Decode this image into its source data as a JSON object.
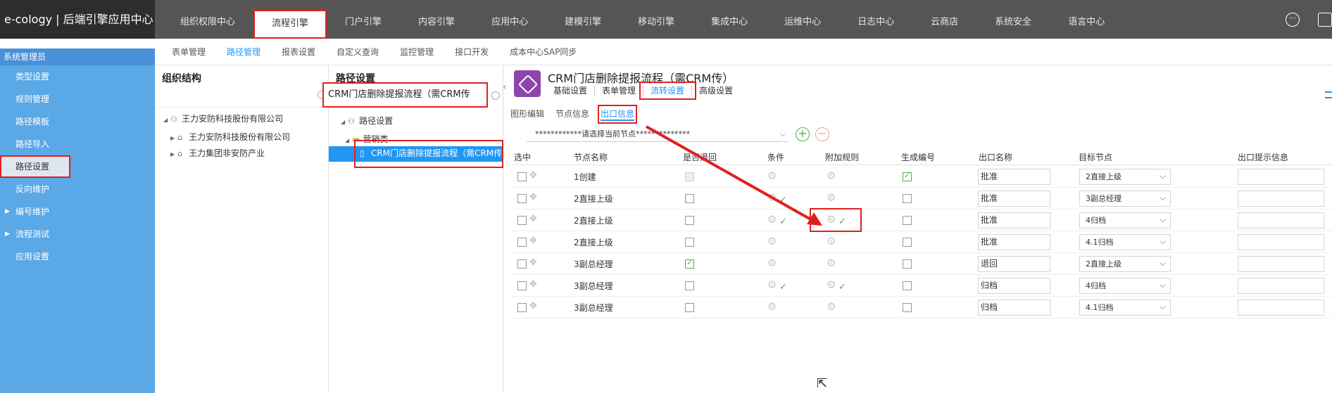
{
  "app": {
    "title": "e-cology | 后端引擎应用中心"
  },
  "topnav": {
    "tabs": [
      "组织权限中心",
      "流程引擎",
      "门户引擎",
      "内容引擎",
      "应用中心",
      "建模引擎",
      "移动引擎",
      "集成中心",
      "运维中心",
      "日志中心",
      "云商店",
      "系统安全",
      "语言中心"
    ],
    "active": "流程引擎",
    "more_icon": "ellipsis-circle-icon"
  },
  "role": "系统管理员",
  "subnav": {
    "items": [
      "表单管理",
      "路径管理",
      "报表设置",
      "自定义查询",
      "监控管理",
      "接口开发",
      "成本中心SAP同步"
    ],
    "active": "路径管理"
  },
  "sidebar": {
    "items": [
      {
        "label": "类型设置"
      },
      {
        "label": "规则管理"
      },
      {
        "label": "路径模板"
      },
      {
        "label": "路径导入"
      },
      {
        "label": "路径设置",
        "active": true
      },
      {
        "label": "反向维护"
      },
      {
        "label": "编号维护",
        "expandable": true
      },
      {
        "label": "流程测试",
        "expandable": true
      },
      {
        "label": "应用设置"
      }
    ]
  },
  "org": {
    "title": "组织结构",
    "tree": [
      {
        "label": "王力安防科技股份有限公司",
        "level": 0
      },
      {
        "label": "王力安防科技股份有限公司",
        "level": 1
      },
      {
        "label": "王力集团非安防产业",
        "level": 1
      }
    ]
  },
  "path_panel": {
    "title": "路径设置",
    "search_value": "CRM门店删除提报流程（需CRM传",
    "tree": [
      {
        "label": "路径设置"
      },
      {
        "label": "营销类"
      },
      {
        "label": "CRM门店删除提报流程（需CRM传",
        "selected": true
      }
    ]
  },
  "workflow": {
    "title": "CRM门店删除提报流程（需CRM传）",
    "tabs": [
      "基础设置",
      "表单管理",
      "流转设置",
      "高级设置"
    ],
    "active_tab": "流转设置",
    "subtabs": [
      "图形编辑",
      "节点信息",
      "出口信息"
    ],
    "active_subtab": "出口信息",
    "node_select": "************请选择当前节点**************"
  },
  "table": {
    "headers": [
      "选中",
      "节点名称",
      "是否退回",
      "条件",
      "附加规则",
      "生成编号",
      "出口名称",
      "目标节点",
      "出口提示信息"
    ],
    "rows": [
      {
        "node": "1创建",
        "is_return": "disabled",
        "cond_set": false,
        "rule_set": false,
        "gen_no": true,
        "exit_name": "批准",
        "target": "2直接上级"
      },
      {
        "node": "2直接上级",
        "is_return": "off",
        "cond_set": true,
        "rule_set": false,
        "gen_no": false,
        "exit_name": "批准",
        "target": "3副总经理"
      },
      {
        "node": "2直接上级",
        "is_return": "off",
        "cond_set": true,
        "rule_set": true,
        "gen_no": false,
        "exit_name": "批准",
        "target": "4归档"
      },
      {
        "node": "2直接上级",
        "is_return": "off",
        "cond_set": false,
        "rule_set": false,
        "gen_no": false,
        "exit_name": "批准",
        "target": "4.1归档"
      },
      {
        "node": "3副总经理",
        "is_return": "on",
        "cond_set": false,
        "rule_set": false,
        "gen_no": false,
        "exit_name": "退回",
        "target": "2直接上级"
      },
      {
        "node": "3副总经理",
        "is_return": "off",
        "cond_set": true,
        "rule_set": true,
        "gen_no": false,
        "exit_name": "归档",
        "target": "4归档"
      },
      {
        "node": "3副总经理",
        "is_return": "off",
        "cond_set": false,
        "rule_set": false,
        "gen_no": false,
        "exit_name": "归档",
        "target": "4.1归档"
      }
    ]
  },
  "colors": {
    "accent": "#2196f3",
    "sidebar": "#5aa8e6",
    "annotation": "#e02020",
    "ok": "#4caf50"
  }
}
